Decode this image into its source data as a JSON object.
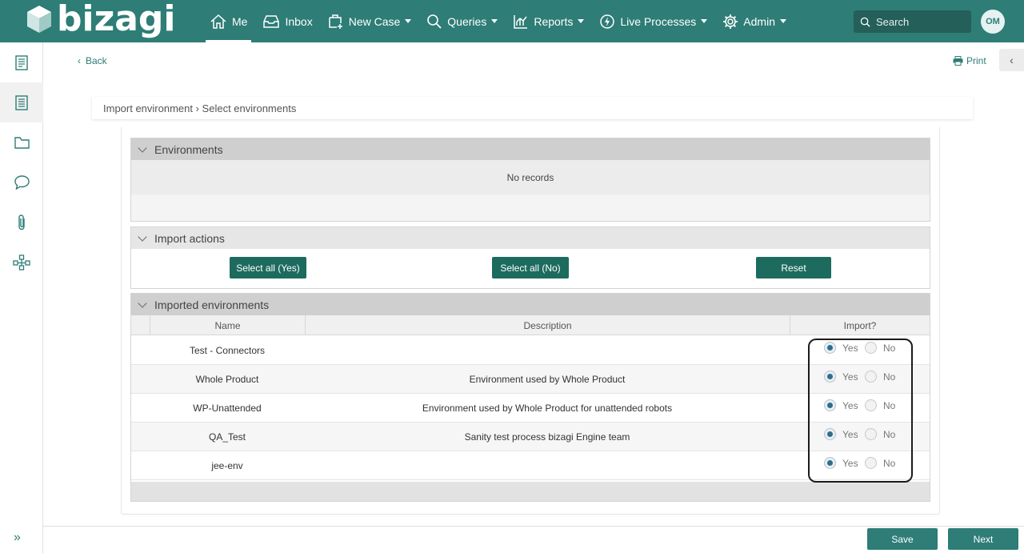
{
  "brand": {
    "name": "bizagi"
  },
  "nav": {
    "items": [
      {
        "label": "Me",
        "icon": "home-icon",
        "active": true,
        "dropdown": false
      },
      {
        "label": "Inbox",
        "icon": "inbox-icon",
        "dropdown": false
      },
      {
        "label": "New Case",
        "icon": "new-case-icon",
        "dropdown": true
      },
      {
        "label": "Queries",
        "icon": "search-icon",
        "dropdown": true
      },
      {
        "label": "Reports",
        "icon": "chart-icon",
        "dropdown": true
      },
      {
        "label": "Live Processes",
        "icon": "lightning-icon",
        "dropdown": true
      },
      {
        "label": "Admin",
        "icon": "gear-icon",
        "dropdown": true
      }
    ]
  },
  "search": {
    "placeholder": "Search"
  },
  "user": {
    "initials": "OM"
  },
  "header": {
    "back_label": "Back",
    "print_label": "Print"
  },
  "breadcrumb": {
    "text": "Import environment › Select environments"
  },
  "environments": {
    "title": "Environments",
    "empty_text": "No records"
  },
  "import_actions": {
    "title": "Import actions",
    "select_all_yes": "Select all (Yes)",
    "select_all_no": "Select all (No)",
    "reset": "Reset"
  },
  "imported": {
    "title": "Imported environments",
    "columns": {
      "name": "Name",
      "description": "Description",
      "import": "Import?"
    },
    "yes_label": "Yes",
    "no_label": "No",
    "rows": [
      {
        "name": "Test - Connectors",
        "description": "",
        "import": "Yes"
      },
      {
        "name": "Whole Product",
        "description": "Environment used by Whole Product",
        "import": "Yes"
      },
      {
        "name": "WP-Unattended",
        "description": "Environment used by Whole Product for unattended robots",
        "import": "Yes"
      },
      {
        "name": "QA_Test",
        "description": "Sanity test process bizagi Engine team",
        "import": "Yes"
      },
      {
        "name": "jee-env",
        "description": "",
        "import": "Yes"
      }
    ]
  },
  "footer": {
    "save_label": "Save",
    "next_label": "Next"
  },
  "colors": {
    "brand": "#2e7d77",
    "button": "#1d6b5e"
  }
}
